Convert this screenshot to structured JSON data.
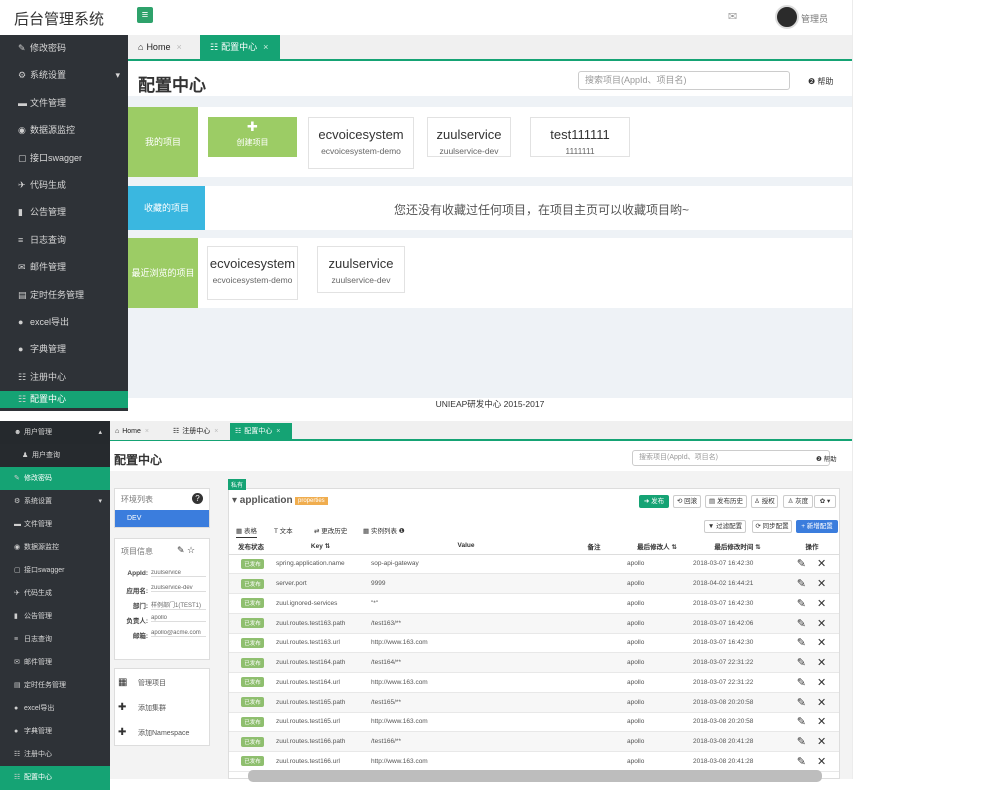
{
  "top": {
    "brand": "后台管理系统",
    "user_name": "管理员",
    "sidebar": [
      {
        "icon": "✎",
        "label": "修改密码"
      },
      {
        "icon": "⚙",
        "label": "系统设置",
        "caret": "▾"
      },
      {
        "icon": "▬",
        "label": "文件管理"
      },
      {
        "icon": "◉",
        "label": "数据源监控"
      },
      {
        "icon": "▢",
        "label": "接口swagger"
      },
      {
        "icon": "✈",
        "label": "代码生成"
      },
      {
        "icon": "▮",
        "label": "公告管理"
      },
      {
        "icon": "≡",
        "label": "日志查询"
      },
      {
        "icon": "✉",
        "label": "邮件管理"
      },
      {
        "icon": "▤",
        "label": "定时任务管理"
      },
      {
        "icon": "●",
        "label": "excel导出"
      },
      {
        "icon": "●",
        "label": "字典管理"
      },
      {
        "icon": "☷",
        "label": "注册中心"
      },
      {
        "icon": "☷",
        "label": "配置中心"
      }
    ],
    "tabs": [
      {
        "icon": "⌂",
        "label": "Home",
        "close": "×"
      },
      {
        "icon": "☷",
        "label": "配置中心",
        "close": "×"
      }
    ],
    "page_title": "配置中心",
    "search_placeholder": "搜索项目(AppId、项目名)",
    "help": "❷ 帮助",
    "my_projects_label": "我的项目",
    "create_icon": "✚",
    "create_label": "创建项目",
    "projects": [
      {
        "name": "ecvoicesystem",
        "sub": "ecvoicesystem-demo"
      },
      {
        "name": "zuulservice",
        "sub": "zuulservice-dev"
      },
      {
        "name": "test111111",
        "sub": "1111111"
      }
    ],
    "fav_label": "收藏的项目",
    "fav_notice": "您还没有收藏过任何项目，在项目主页可以收藏项目哟~",
    "recent_label": "最近浏览的项目",
    "recent": [
      {
        "name": "ecvoicesystem",
        "sub": "ecvoicesystem-demo"
      },
      {
        "name": "zuulservice",
        "sub": "zuulservice-dev"
      }
    ],
    "footer": "UNIEAP研发中心 2015-2017"
  },
  "bottom": {
    "sidebar": [
      {
        "icon": "☻",
        "label": "用户管理",
        "caret": "▴"
      },
      {
        "icon": "♟",
        "label": "用户查询",
        "sub": true
      },
      {
        "icon": "✎",
        "label": "修改密码"
      },
      {
        "icon": "⚙",
        "label": "系统设置",
        "caret": "▾"
      },
      {
        "icon": "▬",
        "label": "文件管理"
      },
      {
        "icon": "◉",
        "label": "数据源监控"
      },
      {
        "icon": "▢",
        "label": "接口swagger"
      },
      {
        "icon": "✈",
        "label": "代码生成"
      },
      {
        "icon": "▮",
        "label": "公告管理"
      },
      {
        "icon": "≡",
        "label": "日志查询"
      },
      {
        "icon": "✉",
        "label": "邮件管理"
      },
      {
        "icon": "▤",
        "label": "定时任务管理"
      },
      {
        "icon": "●",
        "label": "excel导出"
      },
      {
        "icon": "●",
        "label": "字典管理"
      },
      {
        "icon": "☷",
        "label": "注册中心"
      },
      {
        "icon": "☷",
        "label": "配置中心"
      }
    ],
    "tabs": [
      {
        "icon": "⌂",
        "label": "Home",
        "close": "×"
      },
      {
        "icon": "☷",
        "label": "注册中心",
        "close": "×"
      },
      {
        "icon": "☷",
        "label": "配置中心",
        "close": "×"
      }
    ],
    "page_title": "配置中心",
    "search_placeholder": "搜索项目(AppId、项目名)",
    "help": "❷ 帮助",
    "env_title": "环境列表",
    "env_help_icon": "?",
    "env_selected": "DEV",
    "info_title": "项目信息",
    "info_icons": "✎ ☆",
    "info": [
      {
        "k": "AppId:",
        "v": "zuulservice"
      },
      {
        "k": "应用名:",
        "v": "zuulservice-dev"
      },
      {
        "k": "部门:",
        "v": "样例部门1(TEST1)"
      },
      {
        "k": "负责人:",
        "v": "apollo"
      },
      {
        "k": "邮箱:",
        "v": "apollo@acme.com"
      }
    ],
    "actions": [
      {
        "icon": "▦",
        "label": "管理项目"
      },
      {
        "icon": "✚",
        "label": "添加集群"
      },
      {
        "icon": "✚",
        "label": "添加Namespace"
      }
    ],
    "private_badge": "私有",
    "ns_name": "▾ application",
    "ns_format": "properties",
    "buttons": [
      "➜ 发布",
      "⟲ 回滚",
      "▤ 发布历史",
      "♙ 授权",
      "♙ 灰度",
      "✿ ▾"
    ],
    "subtabs": [
      "▦ 表格",
      "T 文本",
      "⇄ 更改历史",
      "▦ 实例列表 ❶"
    ],
    "filter_btn": "▼ 过滤配置",
    "sync_btn": "⟳ 同步配置",
    "add_btn": "+ 新增配置",
    "columns": [
      "发布状态",
      "Key ⇅",
      "Value",
      "备注",
      "最后修改人 ⇅",
      "最后修改时间 ⇅",
      "操作"
    ],
    "rows": [
      {
        "status": "已发布",
        "key": "spring.application.name",
        "value": "sop-api-gateway",
        "comment": "",
        "user": "apollo",
        "time": "2018-03-07 16:42:30",
        "ops": "✎ ✕"
      },
      {
        "status": "已发布",
        "key": "server.port",
        "value": "9999",
        "comment": "",
        "user": "apollo",
        "time": "2018-04-02 16:44:21",
        "ops": "✎ ✕"
      },
      {
        "status": "已发布",
        "key": "zuul.ignored-services",
        "value": "\"*\"",
        "comment": "",
        "user": "apollo",
        "time": "2018-03-07 16:42:30",
        "ops": "✎ ✕"
      },
      {
        "status": "已发布",
        "key": "zuul.routes.test163.path",
        "value": "/test163/**",
        "comment": "",
        "user": "apollo",
        "time": "2018-03-07 16:42:06",
        "ops": "✎ ✕"
      },
      {
        "status": "已发布",
        "key": "zuul.routes.test163.url",
        "value": "http://www.163.com",
        "comment": "",
        "user": "apollo",
        "time": "2018-03-07 16:42:30",
        "ops": "✎ ✕"
      },
      {
        "status": "已发布",
        "key": "zuul.routes.test164.path",
        "value": "/test164/**",
        "comment": "",
        "user": "apollo",
        "time": "2018-03-07 22:31:22",
        "ops": "✎ ✕"
      },
      {
        "status": "已发布",
        "key": "zuul.routes.test164.url",
        "value": "http://www.163.com",
        "comment": "",
        "user": "apollo",
        "time": "2018-03-07 22:31:22",
        "ops": "✎ ✕"
      },
      {
        "status": "已发布",
        "key": "zuul.routes.test165.path",
        "value": "/test165/**",
        "comment": "",
        "user": "apollo",
        "time": "2018-03-08 20:20:58",
        "ops": "✎ ✕"
      },
      {
        "status": "已发布",
        "key": "zuul.routes.test165.url",
        "value": "http://www.163.com",
        "comment": "",
        "user": "apollo",
        "time": "2018-03-08 20:20:58",
        "ops": "✎ ✕"
      },
      {
        "status": "已发布",
        "key": "zuul.routes.test166.path",
        "value": "/test166/**",
        "comment": "",
        "user": "apollo",
        "time": "2018-03-08 20:41:28",
        "ops": "✎ ✕"
      },
      {
        "status": "已发布",
        "key": "zuul.routes.test166.url",
        "value": "http://www.163.com",
        "comment": "",
        "user": "apollo",
        "time": "2018-03-08 20:41:28",
        "ops": "✎ ✕"
      }
    ]
  },
  "colors": {
    "accent": "#15a374",
    "sidebar": "#2e3237",
    "create": "#9ccc65",
    "fav": "#3ab7e0",
    "badge_green": "#8fbf6f"
  }
}
